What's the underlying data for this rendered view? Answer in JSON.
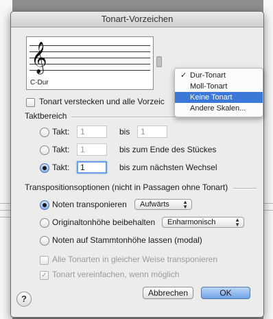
{
  "dialog": {
    "title": "Tonart-Vorzeichen"
  },
  "preview": {
    "clef_glyph": "𝄞",
    "key_label": "C-Dur"
  },
  "hide_key": {
    "checked": false,
    "label": "Tonart verstecken und alle Vorzeic"
  },
  "key_menu": {
    "items": [
      {
        "label": "Dur-Tonart",
        "checked": true,
        "check_glyph": "✓"
      },
      {
        "label": "Moll-Tonart",
        "checked": false
      },
      {
        "label": "Keine Tonart",
        "checked": false,
        "highlighted": true
      },
      {
        "label": "Andere Skalen...",
        "checked": false
      }
    ]
  },
  "measure_range": {
    "title": "Taktbereich",
    "rows": [
      {
        "label": "Takt:",
        "from": "1",
        "middle": "bis",
        "to": "1",
        "selected": false
      },
      {
        "label": "Takt:",
        "from": "1",
        "middle": "bis zum Ende des Stückes",
        "selected": false
      },
      {
        "label": "Takt:",
        "from": "1",
        "middle": "bis zum nächsten Wechsel",
        "selected": true
      }
    ]
  },
  "transposition": {
    "title": "Transpositionsoptionen (nicht in Passagen ohne Tonart)",
    "options": [
      {
        "label": "Noten transponieren",
        "selected": true,
        "popup": "Aufwärts"
      },
      {
        "label": "Originaltonhöhe beibehalten",
        "selected": false,
        "popup": "Enharmonisch"
      },
      {
        "label": "Noten auf Stammtonhöhe lassen (modal)",
        "selected": false
      }
    ],
    "all_keys": {
      "label": "Alle Tonarten in gleicher Weise transponieren",
      "checked": false,
      "enabled": false
    },
    "simplify": {
      "label": "Tonart vereinfachen, wenn möglich",
      "checked": true,
      "enabled": false,
      "check_glyph": "✓"
    }
  },
  "buttons": {
    "help": "?",
    "cancel": "Abbrechen",
    "ok": "OK"
  },
  "glyphs": {
    "popup_arrows_up": "▲",
    "popup_arrows_down": "▼"
  },
  "colors": {
    "highlight": "#3b78d8",
    "default_button": "#6fa1e6"
  }
}
